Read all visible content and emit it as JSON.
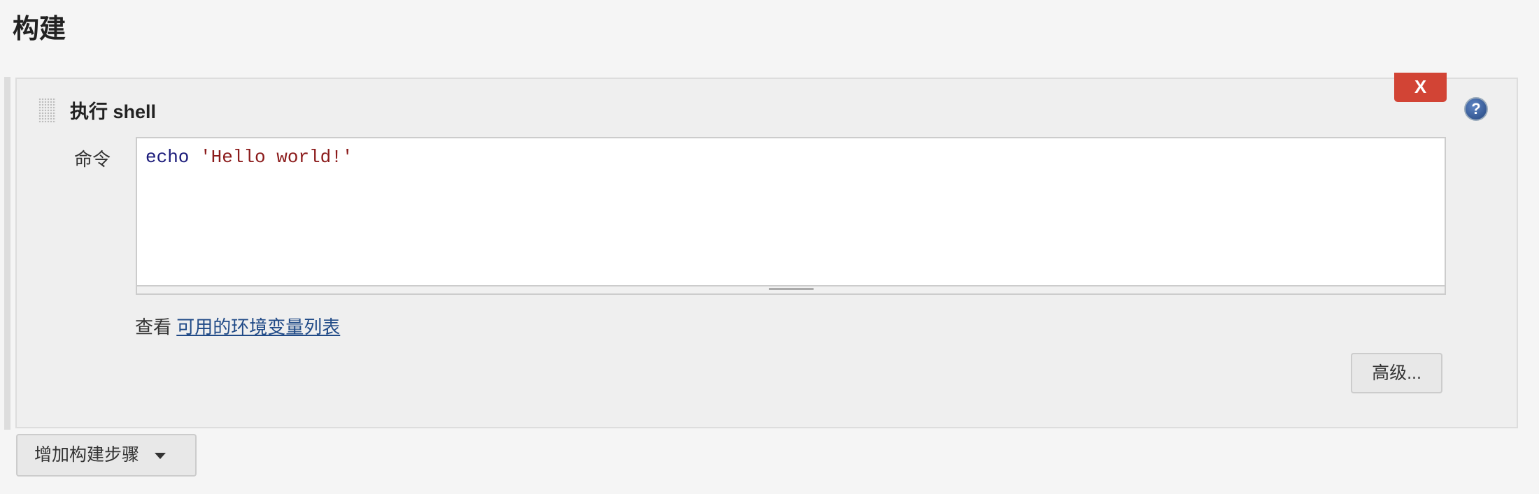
{
  "section_title": "构建",
  "step": {
    "title": "执行 shell",
    "delete_label": "X",
    "help_label": "?",
    "command_label": "命令",
    "command_keyword": "echo",
    "command_string": "'Hello world!'",
    "env_prefix": "查看",
    "env_link": "可用的环境变量列表",
    "advanced_label": "高级..."
  },
  "add_step_label": "增加构建步骤",
  "colors": {
    "delete": "#d24435",
    "link": "#204a87",
    "keyword": "#1a1a7a",
    "string": "#8b1a1a"
  }
}
